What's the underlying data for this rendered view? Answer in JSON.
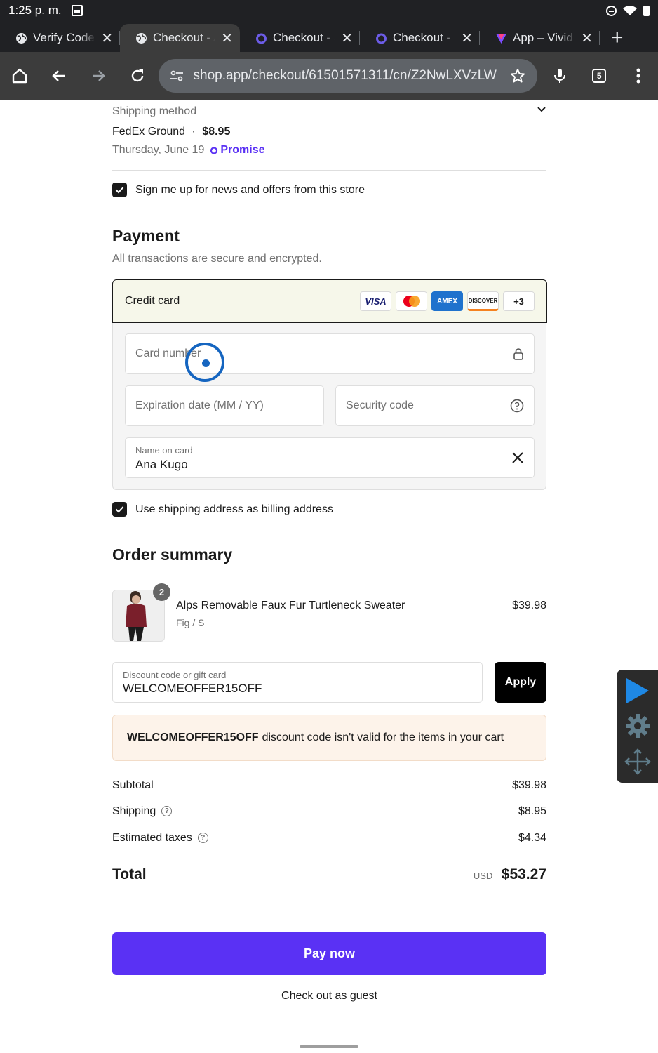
{
  "status_bar": {
    "time": "1:25 p. m."
  },
  "tabs": [
    {
      "title": "Verify Codes",
      "active": false,
      "favicon": "globe-icon"
    },
    {
      "title": "Checkout - Ar",
      "active": true,
      "favicon": "globe-icon"
    },
    {
      "title": "Checkout - St",
      "active": false,
      "favicon": "shop-icon"
    },
    {
      "title": "Checkout - Ün",
      "active": false,
      "favicon": "shop-icon"
    },
    {
      "title": "App – Vivid S",
      "active": false,
      "favicon": "vivid-icon"
    }
  ],
  "toolbar": {
    "url": "shop.app/checkout/61501571311/cn/Z2NwLXVzLW",
    "tab_count": "5"
  },
  "shipping": {
    "header": "Shipping method",
    "carrier": "FedEx Ground",
    "separator": "·",
    "price": "$8.95",
    "date": "Thursday, June 19",
    "promise": "Promise"
  },
  "newsletter": {
    "label": "Sign me up for news and offers from this store",
    "checked": true
  },
  "payment": {
    "heading": "Payment",
    "subheading": "All transactions are secure and encrypted.",
    "method": "Credit card",
    "cards": [
      "VISA",
      "Mastercard",
      "AMEX",
      "DISCOVER",
      "+3"
    ],
    "card_number_placeholder": "Card number",
    "expiry_placeholder": "Expiration date (MM / YY)",
    "security_placeholder": "Security code",
    "name_label": "Name on card",
    "name_value": "Ana Kugo"
  },
  "billing": {
    "label": "Use shipping address as billing address",
    "checked": true
  },
  "order_summary": {
    "heading": "Order summary",
    "item": {
      "name": "Alps Removable Faux Fur Turtleneck Sweater",
      "variant": "Fig / S",
      "price": "$39.98",
      "quantity": "2"
    },
    "discount_label": "Discount code or gift card",
    "discount_value": "WELCOMEOFFER15OFF",
    "apply_label": "Apply",
    "alert_code": "WELCOMEOFFER15OFF",
    "alert_text": "discount code isn't valid for the items in your cart",
    "subtotal_label": "Subtotal",
    "subtotal": "$39.98",
    "shipping_label": "Shipping",
    "shipping": "$8.95",
    "taxes_label": "Estimated taxes",
    "taxes": "$4.34",
    "total_label": "Total",
    "currency": "USD",
    "total": "$53.27"
  },
  "pay_now": "Pay now",
  "guest": "Check out as guest",
  "colors": {
    "accent": "#5a31f4",
    "alert_bg": "#fdf3ea",
    "payment_header_bg": "#f6f7ea"
  }
}
